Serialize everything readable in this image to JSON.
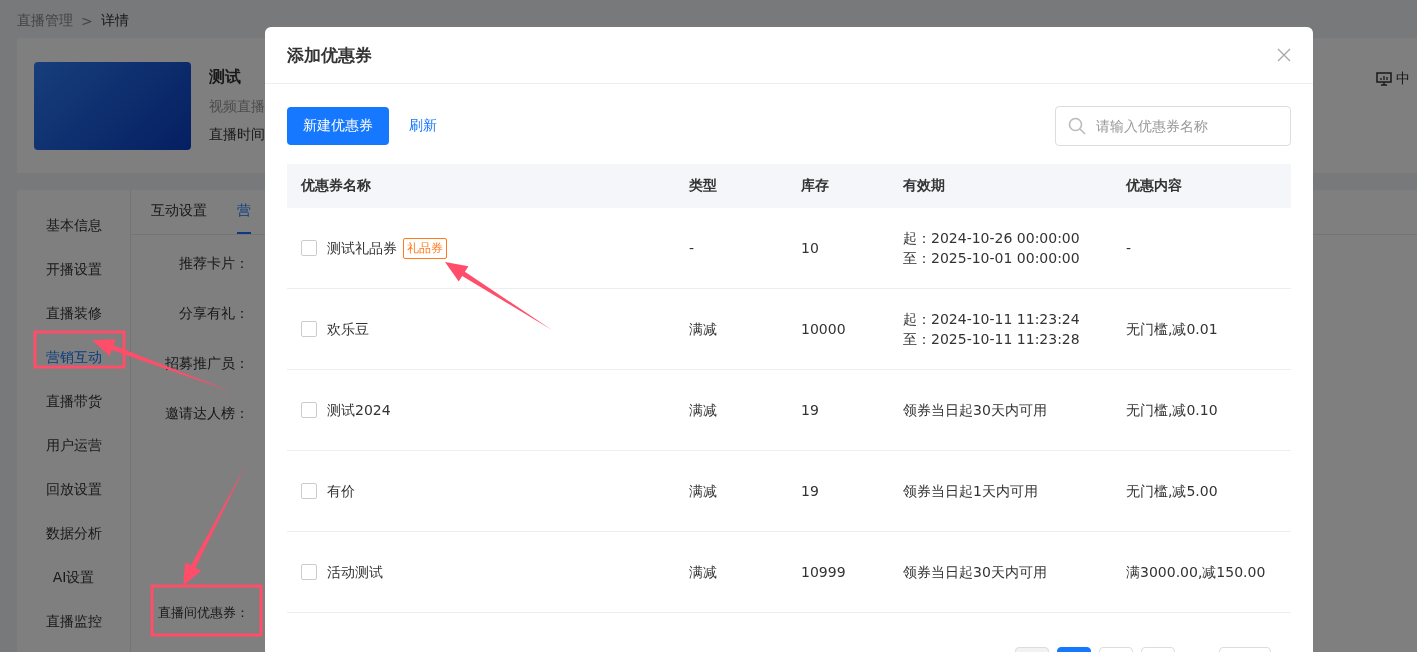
{
  "breadcrumb": {
    "parent": "直播管理",
    "separator": ">",
    "current": "详情"
  },
  "live": {
    "title": "测试",
    "type": "视频直播",
    "time_label": "直播时间"
  },
  "top_action": {
    "label": "中"
  },
  "sidebar": {
    "items": [
      {
        "label": "基本信息",
        "selected": false
      },
      {
        "label": "开播设置",
        "selected": false
      },
      {
        "label": "直播装修",
        "selected": false
      },
      {
        "label": "营销互动",
        "selected": true
      },
      {
        "label": "直播带货",
        "selected": false
      },
      {
        "label": "用户运营",
        "selected": false
      },
      {
        "label": "回放设置",
        "selected": false
      },
      {
        "label": "数据分析",
        "selected": false
      },
      {
        "label": "AI设置",
        "selected": false
      },
      {
        "label": "直播监控",
        "selected": false
      }
    ]
  },
  "tabs": [
    {
      "label": "互动设置",
      "selected": false
    },
    {
      "label": "营",
      "selected": true
    }
  ],
  "form_labels": [
    "推荐卡片：",
    "分享有礼：",
    "招募推广员：",
    "邀请达人榜：",
    "直播间优惠券："
  ],
  "dialog": {
    "title": "添加优惠券",
    "new_button": "新建优惠券",
    "refresh_link": "刷新",
    "search": {
      "placeholder": "请输入优惠券名称"
    },
    "columns": [
      "优惠券名称",
      "类型",
      "库存",
      "有效期",
      "优惠内容"
    ],
    "rows": [
      {
        "checked": false,
        "name": "测试礼品券",
        "tag": "礼品券",
        "type": "-",
        "stock": "10",
        "validity": [
          "起：2024-10-26 00:00:00",
          "至：2025-10-01 00:00:00"
        ],
        "content": "-"
      },
      {
        "checked": false,
        "name": "欢乐豆",
        "type": "满减",
        "stock": "10000",
        "validity": [
          "起：2024-10-11 11:23:24",
          "至：2025-10-11 11:23:28"
        ],
        "content": "无门槛,减0.01"
      },
      {
        "checked": false,
        "name": "测试2024",
        "type": "满减",
        "stock": "19",
        "validity": [
          "领券当日起30天内可用"
        ],
        "content": "无门槛,减0.10"
      },
      {
        "checked": false,
        "name": "有价",
        "type": "满减",
        "stock": "19",
        "validity": [
          "领券当日起1天内可用"
        ],
        "content": "无门槛,减5.00"
      },
      {
        "checked": false,
        "name": "活动测试",
        "type": "满减",
        "stock": "10999",
        "validity": [
          "领券当日起30天内可用"
        ],
        "content": "满3000.00,减150.00"
      }
    ],
    "pagination": [
      {
        "kind": "prev",
        "selected": false
      },
      {
        "kind": "page",
        "selected": true
      },
      {
        "kind": "page",
        "selected": false
      },
      {
        "kind": "page",
        "selected": false
      },
      {
        "kind": "gap",
        "selected": false
      },
      {
        "kind": "size",
        "selected": false
      }
    ]
  }
}
